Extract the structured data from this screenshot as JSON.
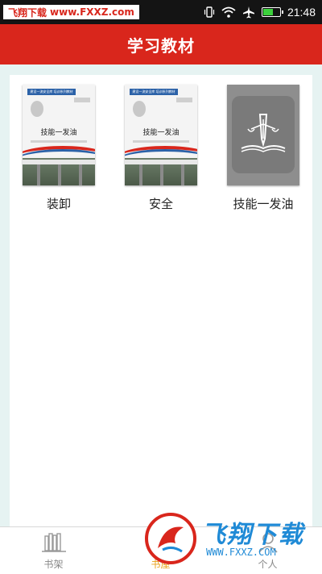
{
  "status_bar": {
    "watermark_site": "飞翔下载",
    "watermark_url": "www.FXXZ.com",
    "time": "21:48"
  },
  "header": {
    "title": "学习教材"
  },
  "books": [
    {
      "label": "装卸",
      "cover_title": "技能一发油",
      "cover_band": "建设一流安全库 培训系列教材"
    },
    {
      "label": "安全",
      "cover_title": "技能一发油",
      "cover_band": "建设一流安全库 培训系列教材"
    },
    {
      "label": "技能一发油"
    }
  ],
  "bottom_nav": {
    "items": [
      {
        "label": "书架",
        "icon": "bookshelf-icon"
      },
      {
        "label": "书屋",
        "icon": "bookstore-icon",
        "active": true
      },
      {
        "label": "个人",
        "icon": "person-icon"
      }
    ]
  },
  "watermark": {
    "brand": "飞翔下载",
    "url": "WWW.FXXZ.COM"
  },
  "colors": {
    "header": "#d9261c",
    "active_nav": "#e8a21a",
    "background": "#e6f3f2"
  }
}
